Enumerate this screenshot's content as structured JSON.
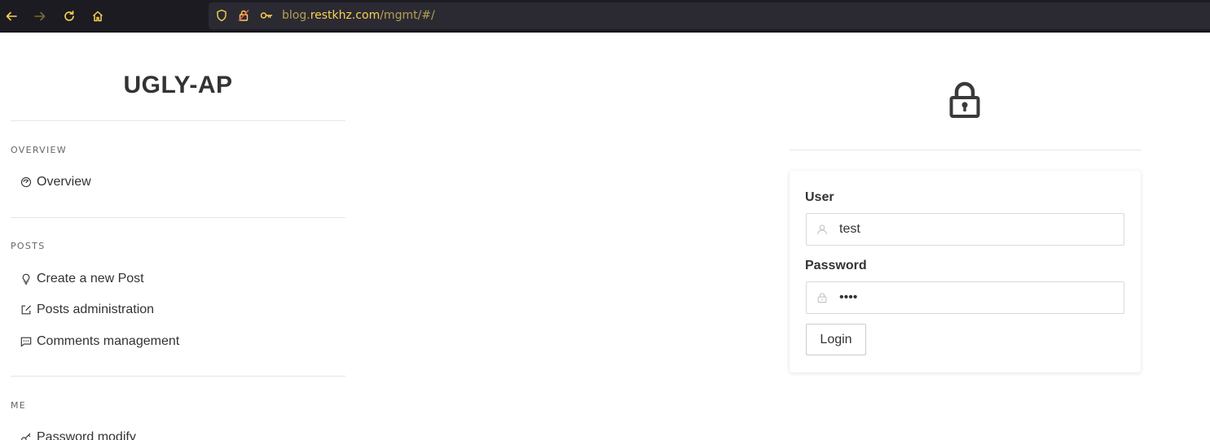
{
  "browser": {
    "url_prefix": "blog.",
    "url_host": "restkhz.com",
    "url_path": "/mgmt/#/",
    "back_icon": "arrow-left-icon",
    "forward_icon": "arrow-right-icon",
    "reload_icon": "reload-icon",
    "home_icon": "home-icon"
  },
  "sidebar": {
    "app_title": "UGLY-AP",
    "sections": [
      {
        "label": "OVERVIEW",
        "items": [
          {
            "label": "Overview",
            "icon": "dashboard-icon"
          }
        ]
      },
      {
        "label": "POSTS",
        "items": [
          {
            "label": "Create a new Post",
            "icon": "bulb-icon"
          },
          {
            "label": "Posts administration",
            "icon": "edit-icon"
          },
          {
            "label": "Comments management",
            "icon": "message-icon"
          }
        ]
      },
      {
        "label": "ME",
        "items": [
          {
            "label": "Password modify",
            "icon": "key-icon"
          }
        ]
      }
    ]
  },
  "login": {
    "user_label": "User",
    "user_value": "test",
    "password_label": "Password",
    "password_value": "test",
    "login_button": "Login"
  },
  "colors": {
    "toolbar_bg": "#1c1b22",
    "urlbar_bg": "#2b2a33",
    "url_accent": "#fbd24f",
    "text": "#333333"
  }
}
